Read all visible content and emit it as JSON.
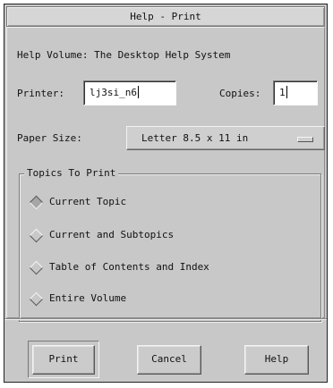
{
  "window": {
    "title": "Help - Print"
  },
  "help_volume_label": "Help Volume: The Desktop Help System",
  "printer": {
    "label": "Printer:",
    "value": "lj3si_n6"
  },
  "copies": {
    "label": "Copies:",
    "value": "1"
  },
  "paper_size": {
    "label": "Paper Size:",
    "selected": "Letter 8.5 x 11 in"
  },
  "topics": {
    "title": "Topics To Print",
    "options": [
      {
        "label": "Current Topic",
        "selected": true
      },
      {
        "label": "Current and Subtopics",
        "selected": false
      },
      {
        "label": "Table of Contents and Index",
        "selected": false
      },
      {
        "label": "Entire Volume",
        "selected": false
      }
    ]
  },
  "buttons": {
    "print": "Print",
    "cancel": "Cancel",
    "help": "Help"
  }
}
